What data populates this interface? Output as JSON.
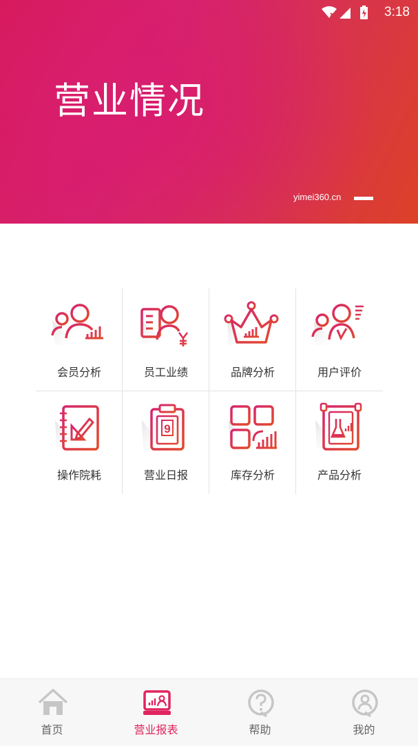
{
  "status": {
    "time": "3:18"
  },
  "banner": {
    "title": "营业情况",
    "site": "yimei360.cn"
  },
  "grid": {
    "items": [
      {
        "label": "会员分析",
        "icon": "member-analysis-icon"
      },
      {
        "label": "员工业绩",
        "icon": "staff-performance-icon"
      },
      {
        "label": "品牌分析",
        "icon": "brand-analysis-icon"
      },
      {
        "label": "用户评价",
        "icon": "user-review-icon"
      },
      {
        "label": "操作院耗",
        "icon": "operation-consumption-icon"
      },
      {
        "label": "营业日报",
        "icon": "daily-report-icon"
      },
      {
        "label": "库存分析",
        "icon": "inventory-analysis-icon"
      },
      {
        "label": "产品分析",
        "icon": "product-analysis-icon"
      }
    ]
  },
  "tabbar": {
    "tabs": [
      {
        "label": "首页",
        "icon": "home-icon"
      },
      {
        "label": "营业报表",
        "icon": "report-icon",
        "active": true
      },
      {
        "label": "帮助",
        "icon": "help-icon"
      },
      {
        "label": "我的",
        "icon": "profile-icon"
      }
    ]
  },
  "colors": {
    "accent": "#e0245e",
    "gradient_start": "#d81a5a",
    "gradient_end": "#dc4127"
  }
}
